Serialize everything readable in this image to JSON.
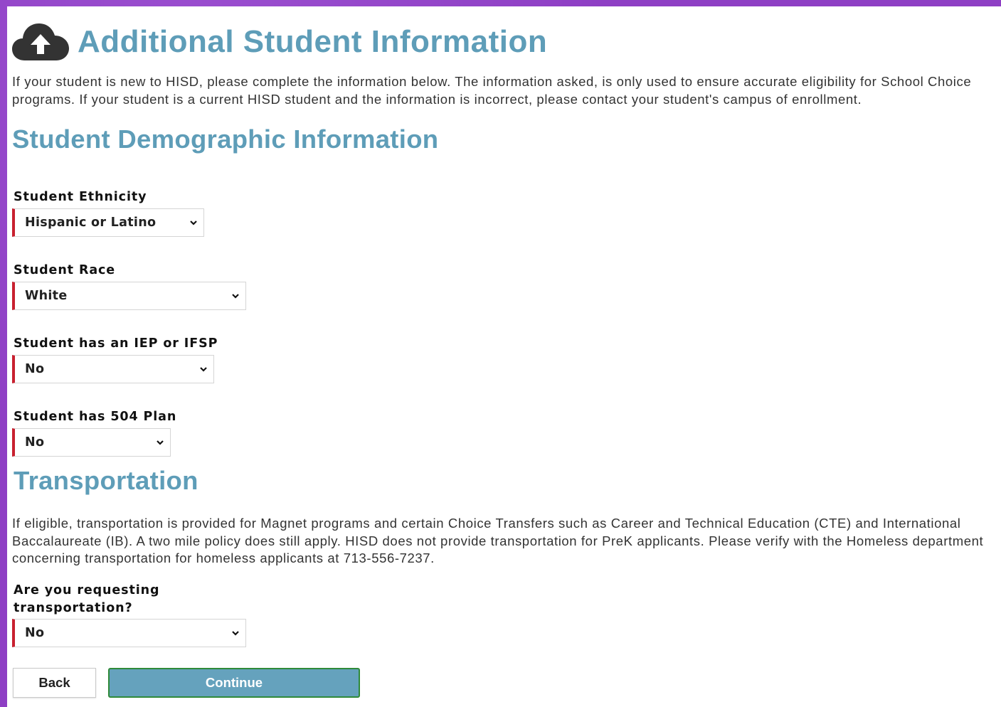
{
  "header": {
    "icon": "cloud-upload-icon",
    "title": "Additional Student Information"
  },
  "intro_text": "If your student is new to HISD, please complete the information below. The information asked, is only used to ensure accurate eligibility for School Choice programs. If your student is a current HISD student and the information is incorrect, please contact your student's campus of enrollment.",
  "demographics": {
    "heading": "Student Demographic Information",
    "ethnicity": {
      "label": "Student Ethnicity",
      "value": "Hispanic or Latino"
    },
    "race": {
      "label": "Student Race",
      "value": "White"
    },
    "iep": {
      "label": "Student has an IEP or IFSP",
      "value": "No"
    },
    "plan504": {
      "label": "Student has 504 Plan",
      "value": "No"
    }
  },
  "transportation": {
    "heading": "Transportation",
    "text": "If eligible, transportation is provided for Magnet programs and certain Choice Transfers such as Career and Technical Education (CTE) and International Baccalaureate (IB). A two mile policy does still apply. HISD does not provide transportation for PreK applicants. Please verify with the Homeless department concerning transportation for homeless applicants at 713-556-7237.",
    "request": {
      "label": "Are you requesting transportation?",
      "value": "No"
    }
  },
  "buttons": {
    "back": "Back",
    "continue": "Continue"
  },
  "colors": {
    "heading": "#5e9db8",
    "required_marker": "#c8202f",
    "continue_bg": "#65a2bd",
    "continue_border": "#2f8a3a",
    "page_background": "#8e3fc4"
  }
}
